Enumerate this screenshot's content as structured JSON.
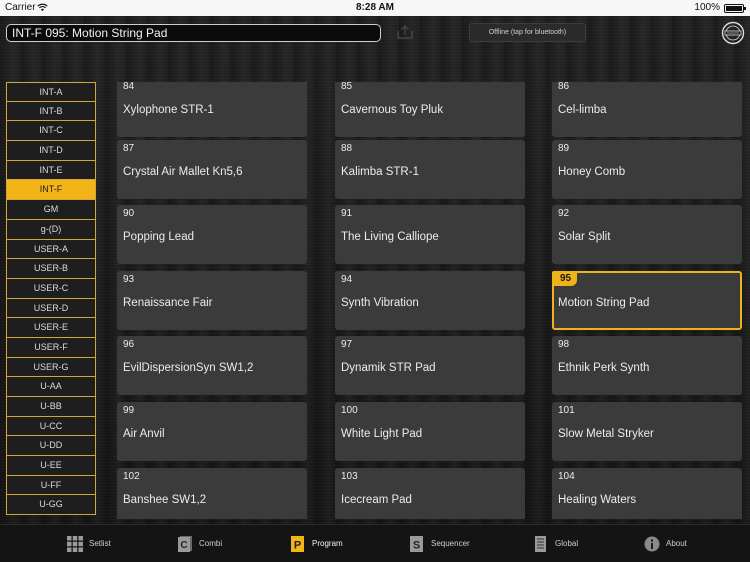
{
  "status_bar": {
    "carrier": "Carrier",
    "time": "8:28 AM",
    "battery": "100%"
  },
  "header": {
    "program_name": "INT-F 095: Motion String Pad",
    "bluetooth_button": "Offline (tap for bluetooth)"
  },
  "banks": [
    "INT-A",
    "INT-B",
    "INT-C",
    "INT-D",
    "INT-E",
    "INT-F",
    "GM",
    "g-(D)",
    "USER-A",
    "USER-B",
    "USER-C",
    "USER-D",
    "USER-E",
    "USER-F",
    "USER-G",
    "U-AA",
    "U-BB",
    "U-CC",
    "U-DD",
    "U-EE",
    "U-FF",
    "U-GG"
  ],
  "selected_bank": "INT-F",
  "programs": [
    {
      "num": "84",
      "name": "Xylophone STR-1"
    },
    {
      "num": "85",
      "name": "Cavernous Toy Pluk"
    },
    {
      "num": "86",
      "name": "Cel-limba"
    },
    {
      "num": "87",
      "name": "Crystal Air Mallet Kn5,6"
    },
    {
      "num": "88",
      "name": "Kalimba STR-1"
    },
    {
      "num": "89",
      "name": "Honey Comb"
    },
    {
      "num": "90",
      "name": "Popping Lead"
    },
    {
      "num": "91",
      "name": "The Living Calliope"
    },
    {
      "num": "92",
      "name": "Solar Split"
    },
    {
      "num": "93",
      "name": "Renaissance Fair"
    },
    {
      "num": "94",
      "name": "Synth Vibration"
    },
    {
      "num": "95",
      "name": "Motion String Pad"
    },
    {
      "num": "96",
      "name": "EvilDispersionSyn SW1,2"
    },
    {
      "num": "97",
      "name": "Dynamik STR Pad"
    },
    {
      "num": "98",
      "name": "Ethnik Perk Synth"
    },
    {
      "num": "99",
      "name": "Air Anvil"
    },
    {
      "num": "100",
      "name": "White Light Pad"
    },
    {
      "num": "101",
      "name": "Slow Metal Stryker"
    },
    {
      "num": "102",
      "name": "Banshee SW1,2"
    },
    {
      "num": "103",
      "name": "Icecream Pad"
    },
    {
      "num": "104",
      "name": "Healing Waters"
    }
  ],
  "selected_program": "95",
  "tabs": [
    {
      "label": "Setlist",
      "icon": "grid-icon"
    },
    {
      "label": "Combi",
      "icon": "combi-icon"
    },
    {
      "label": "Program",
      "icon": "program-icon",
      "active": true
    },
    {
      "label": "Sequencer",
      "icon": "sequencer-icon"
    },
    {
      "label": "Global",
      "icon": "global-icon"
    },
    {
      "label": "About",
      "icon": "info-icon"
    }
  ],
  "colors": {
    "accent": "#f2b416",
    "tile": "#3b3b3b"
  }
}
